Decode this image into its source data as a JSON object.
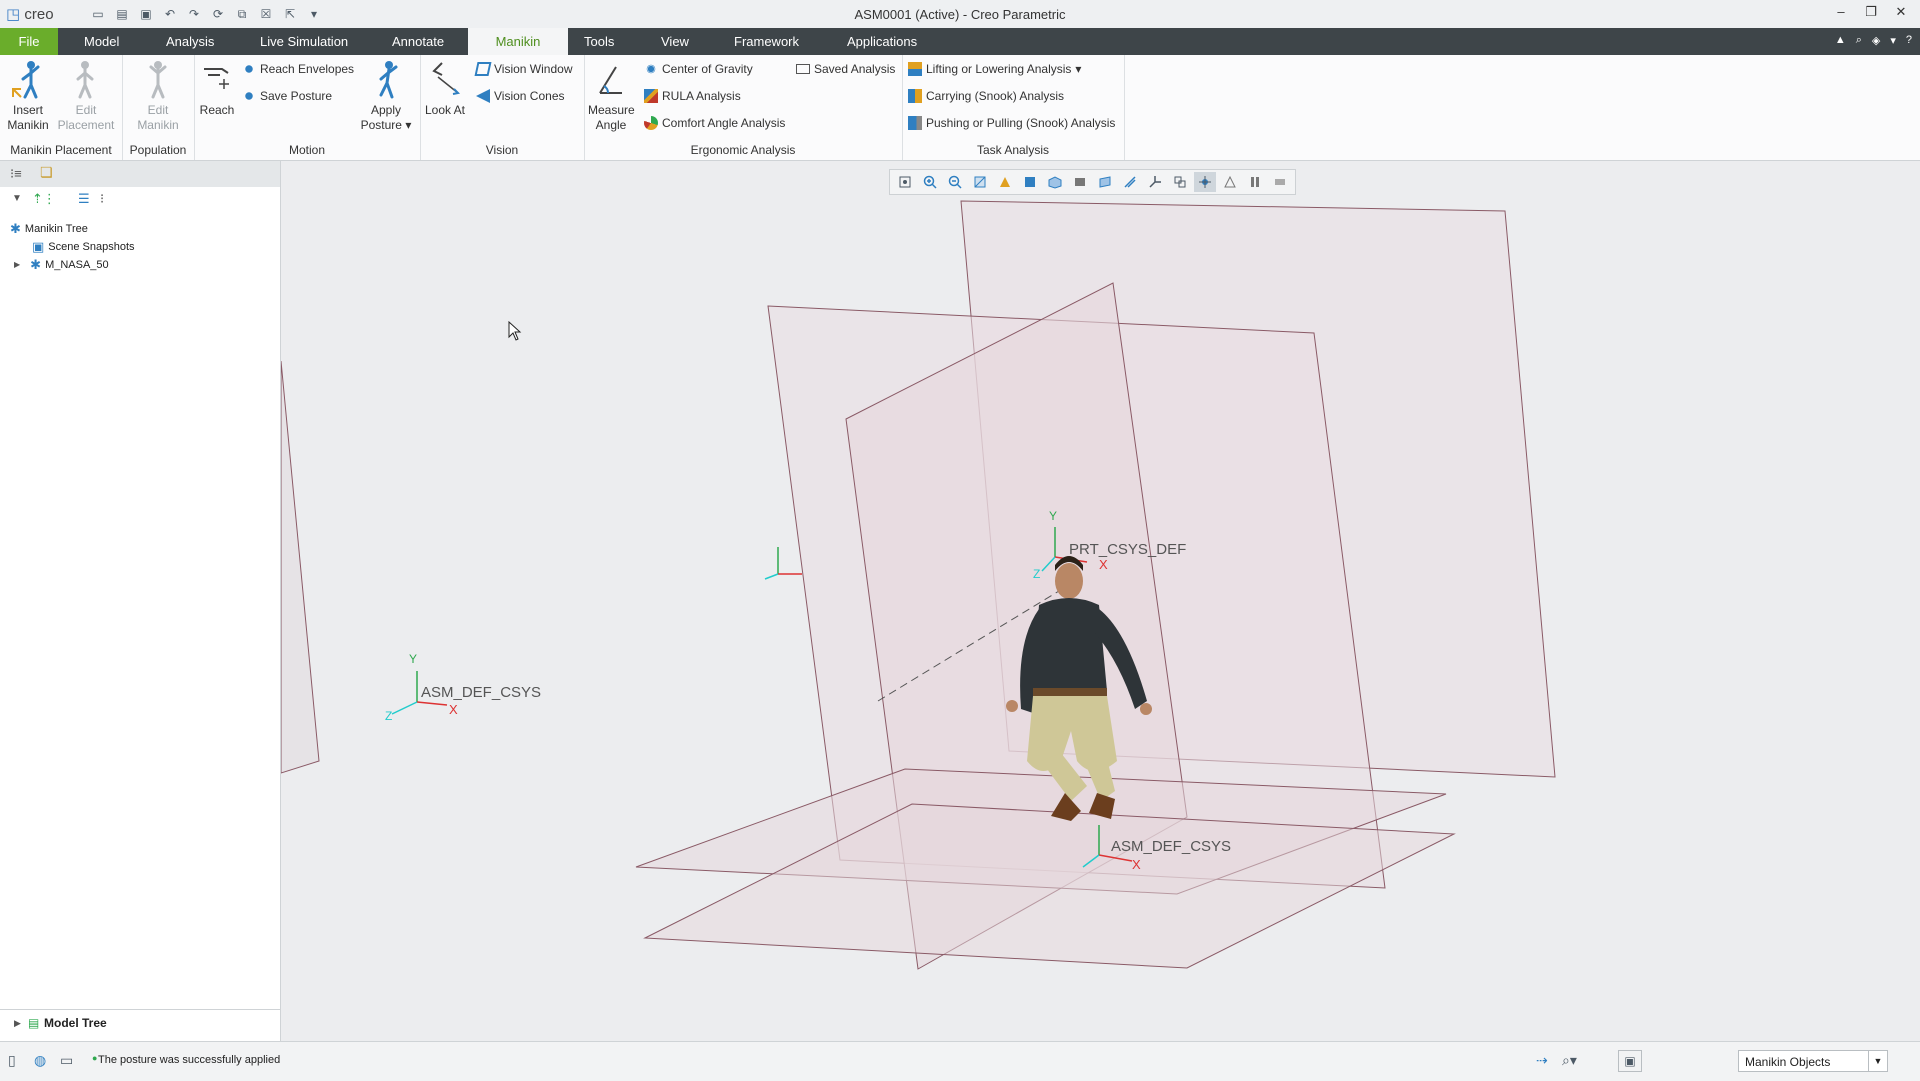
{
  "app": {
    "brand": "creo",
    "title": "ASM0001 (Active) - Creo Parametric"
  },
  "tabs": [
    {
      "label": "File"
    },
    {
      "label": "Model"
    },
    {
      "label": "Analysis"
    },
    {
      "label": "Live Simulation"
    },
    {
      "label": "Annotate"
    },
    {
      "label": "Manikin"
    },
    {
      "label": "Tools"
    },
    {
      "label": "View"
    },
    {
      "label": "Framework"
    },
    {
      "label": "Applications"
    }
  ],
  "active_tab": "Manikin",
  "ribbon": {
    "groups": {
      "placement": "Manikin Placement",
      "population": "Population",
      "motion": "Motion",
      "vision": "Vision",
      "ergonomic": "Ergonomic Analysis",
      "task": "Task Analysis"
    },
    "insert_manikin": [
      "Insert",
      "Manikin"
    ],
    "edit_placement": [
      "Edit",
      "Placement"
    ],
    "edit_manikin": [
      "Edit",
      "Manikin"
    ],
    "reach": "Reach",
    "reach_envelopes": "Reach Envelopes",
    "save_posture": "Save Posture",
    "apply_posture": [
      "Apply",
      "Posture"
    ],
    "look_at": "Look At",
    "vision_window": "Vision Window",
    "vision_cones": "Vision Cones",
    "measure_angle": [
      "Measure",
      "Angle"
    ],
    "center_of_gravity": "Center of Gravity",
    "saved_analysis": "Saved Analysis",
    "rula": "RULA Analysis",
    "comfort_angle": "Comfort Angle Analysis",
    "lifting": "Lifting or Lowering Analysis",
    "carrying": "Carrying (Snook) Analysis",
    "pushing": "Pushing or Pulling (Snook) Analysis"
  },
  "tree": {
    "root": "Manikin Tree",
    "items": [
      "Scene Snapshots",
      "M_NASA_50"
    ],
    "footer": "Model Tree"
  },
  "viewport": {
    "labels": {
      "asm_left": "ASM_DEF_CSYS",
      "asm_floor": "ASM_DEF_CSYS",
      "prt": "PRT_CSYS_DEF"
    },
    "axis": {
      "x": "X",
      "y": "Y",
      "z": "Z"
    }
  },
  "status": {
    "message": "The posture was successfully applied",
    "filter": "Manikin Objects"
  },
  "colors": {
    "file_tab": "#6aad2b",
    "tabbar": "#3e4549",
    "active_tab_text": "#4f8f1f",
    "viewport_bg": "#ecedef",
    "plane_fill": "#e9dde1",
    "plane_edge": "#8a5a66"
  }
}
